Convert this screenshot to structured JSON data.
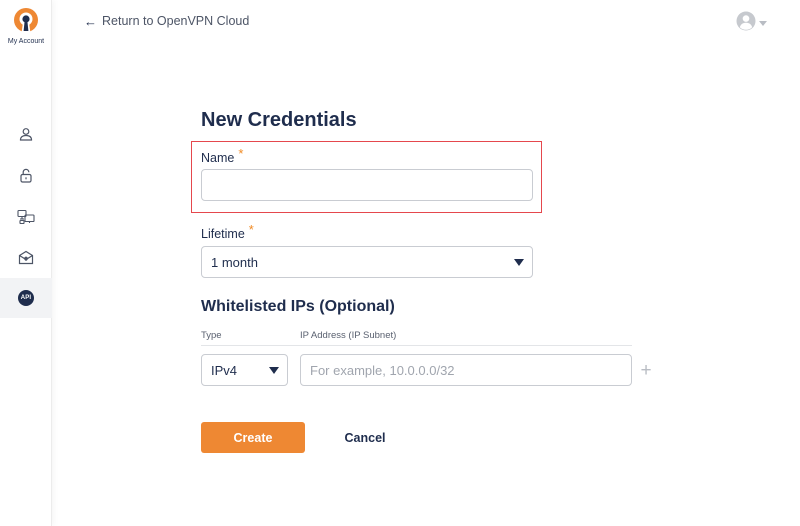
{
  "sidebar": {
    "account_label": "My Account",
    "items": [
      {
        "icon": "user-icon"
      },
      {
        "icon": "lock-icon"
      },
      {
        "icon": "devices-icon"
      },
      {
        "icon": "mail-shield-icon"
      },
      {
        "icon": "api-icon",
        "label": "API",
        "active": true
      }
    ]
  },
  "header": {
    "back_label": "Return to OpenVPN Cloud",
    "user_icon": "user-avatar-icon"
  },
  "form": {
    "title": "New Credentials",
    "name_label": "Name",
    "required_mark": "*",
    "name_value": "",
    "lifetime_label": "Lifetime",
    "lifetime_value": "1 month",
    "whitelist_title": "Whitelisted IPs (Optional)",
    "type_header": "Type",
    "ip_header": "IP Address (IP Subnet)",
    "type_value": "IPv4",
    "ip_placeholder": "For example, 10.0.0.0/32",
    "add_label": "+",
    "create_label": "Create",
    "cancel_label": "Cancel"
  },
  "colors": {
    "accent": "#ee8833",
    "navy": "#1f2d4d",
    "highlight": "#e5484d"
  }
}
